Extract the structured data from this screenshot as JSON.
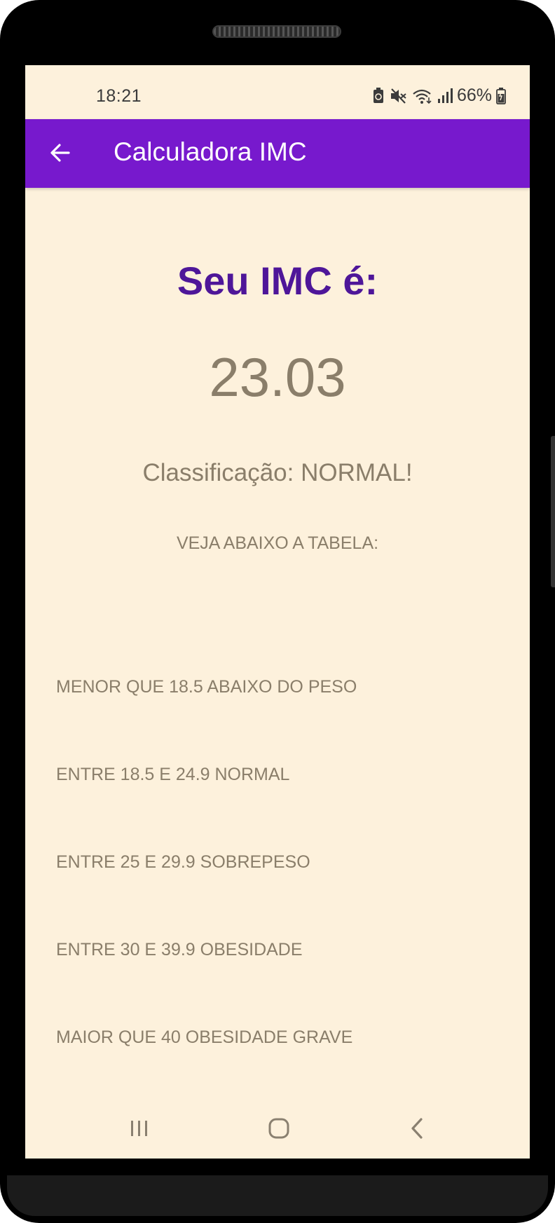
{
  "status_bar": {
    "time": "18:21",
    "battery_percent": "66%",
    "icons": [
      "battery-saver-icon",
      "mute-icon",
      "wifi-icon",
      "signal-icon",
      "battery-icon"
    ]
  },
  "app_bar": {
    "title": "Calculadora IMC",
    "back_icon": "arrow-back-icon",
    "color": "#7719cd"
  },
  "result": {
    "heading": "Seu IMC é:",
    "value": "23.03",
    "classification": "Classificação: NORMAL!"
  },
  "table": {
    "intro": "VEJA ABAIXO A TABELA:",
    "rows": [
      "MENOR QUE 18.5 ABAIXO DO PESO",
      "ENTRE 18.5 E 24.9 NORMAL",
      "ENTRE 25 E 29.9 SOBREPESO",
      "ENTRE 30 E 39.9 OBESIDADE",
      "MAIOR QUE 40 OBESIDADE GRAVE"
    ]
  },
  "navigation": {
    "buttons": [
      "recent-apps-icon",
      "home-icon",
      "back-icon"
    ]
  },
  "colors": {
    "background": "#fdf1dc",
    "heading": "#4e1699",
    "text": "#8a7e6a"
  }
}
